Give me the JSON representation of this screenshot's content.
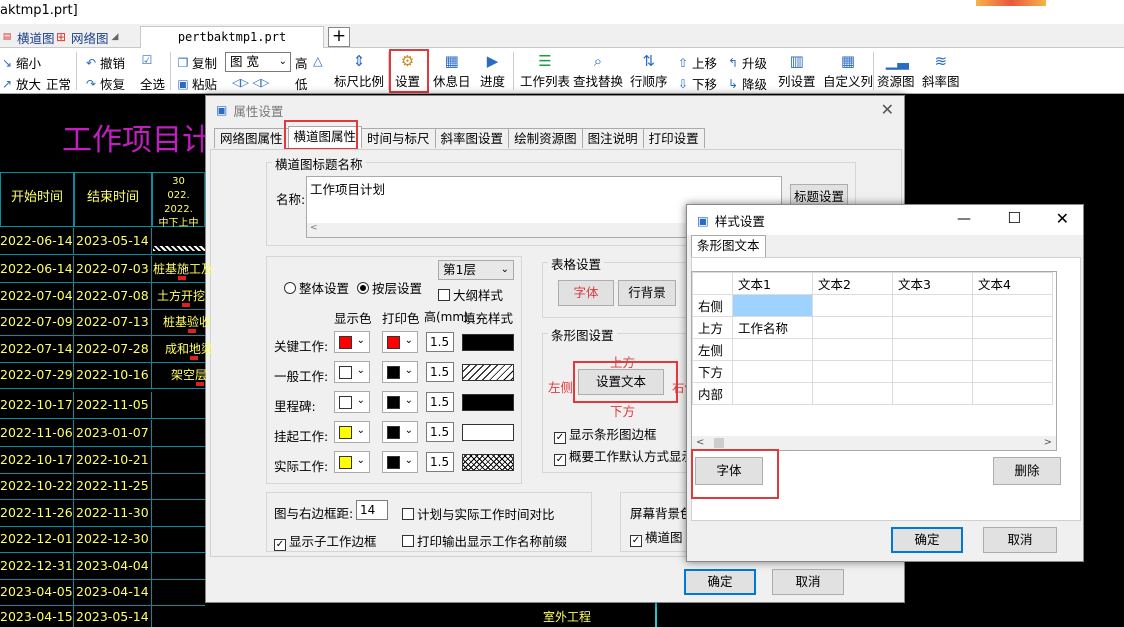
{
  "window": {
    "title_fragment": "aktmp1.prt]"
  },
  "tabbar": {
    "tabs": [
      {
        "label": "横道图",
        "icon": "gantt-icon"
      },
      {
        "label": "网络图",
        "icon": "network-icon"
      }
    ],
    "doc_tab": "pertbaktmp1.prt",
    "add_tab": "+"
  },
  "toolbar": {
    "zoom_out": "缩小",
    "zoom_in": "放大",
    "normal": "正常",
    "undo": "撤销",
    "redo": "恢复",
    "select_all": "全选",
    "copy": "复制",
    "paste": "粘贴",
    "view_select": "图 宽",
    "high": "高",
    "low": "低",
    "scale": "标尺比例",
    "settings": "设置",
    "holiday": "休息日",
    "progress": "进度",
    "work_list": "工作列表",
    "find_replace": "查找替换",
    "row_order": "行顺序",
    "move_up": "上移",
    "move_down": "下移",
    "upgrade": "升级",
    "downgrade": "降级",
    "col_settings": "列设置",
    "custom": "自定义列",
    "resource": "资源图",
    "slope": "斜率图"
  },
  "gantt": {
    "title": "工作项目计",
    "headers": {
      "start": "开始时间",
      "end": "结束时间",
      "scale_top": "30",
      "scale_mid": "022. 2022.",
      "scale_bot": "中下上中"
    },
    "rows": [
      {
        "start": "2022-06-14",
        "end": "2023-05-14",
        "task": ""
      },
      {
        "start": "2022-06-14",
        "end": "2022-07-03",
        "task": "桩基施工及"
      },
      {
        "start": "2022-07-04",
        "end": "2022-07-08",
        "task": "土方开挖"
      },
      {
        "start": "2022-07-09",
        "end": "2022-07-13",
        "task": "桩基验收"
      },
      {
        "start": "2022-07-14",
        "end": "2022-07-28",
        "task": "成和地梁"
      },
      {
        "start": "2022-07-29",
        "end": "2022-10-16",
        "task": "架空层"
      },
      {
        "start": "2022-10-17",
        "end": "2022-11-05",
        "task": ""
      },
      {
        "start": "2022-11-06",
        "end": "2023-01-07",
        "task": ""
      },
      {
        "start": "2022-10-17",
        "end": "2022-10-21",
        "task": ""
      },
      {
        "start": "2022-10-22",
        "end": "2022-11-25",
        "task": ""
      },
      {
        "start": "2022-11-26",
        "end": "2022-11-30",
        "task": ""
      },
      {
        "start": "2022-12-01",
        "end": "2022-12-30",
        "task": ""
      },
      {
        "start": "2022-12-31",
        "end": "2023-04-04",
        "task": ""
      },
      {
        "start": "2023-04-05",
        "end": "2023-04-14",
        "task": ""
      },
      {
        "start": "2023-04-15",
        "end": "2023-05-14",
        "task": "室外工程"
      }
    ]
  },
  "prop_dialog": {
    "title": "属性设置",
    "tabs": [
      "网络图属性",
      "横道图属性",
      "时间与标尺",
      "斜率图设置",
      "绘制资源图",
      "图注说明",
      "打印设置"
    ],
    "active_tab": "横道图属性",
    "title_group": "横道图标题名称",
    "name_label": "名称:",
    "name_value": "工作项目计划",
    "title_settings_btn": "标题设置",
    "radio_all": "整体设置",
    "radio_layer": "按层设置",
    "layer_select": "第1层",
    "outline_style": "大纲样式",
    "col_headers": {
      "display": "显示色",
      "print": "打印色",
      "height": "高(mm)",
      "fill": "填充样式"
    },
    "work_types": [
      {
        "label": "关键工作:",
        "display_color": "#ff0000",
        "print_color": "#ff0000",
        "height": "1.5",
        "fill": "solid"
      },
      {
        "label": "一般工作:",
        "display_color": "#ffffff",
        "print_color": "#000000",
        "height": "1.5",
        "fill": "hatch"
      },
      {
        "label": "里程碑:",
        "display_color": "#ffffff",
        "print_color": "#000000",
        "height": "1.5",
        "fill": "solid"
      },
      {
        "label": "挂起工作:",
        "display_color": "#ffff00",
        "print_color": "#000000",
        "height": "1.5",
        "fill": "empty"
      },
      {
        "label": "实际工作:",
        "display_color": "#ffff00",
        "print_color": "#000000",
        "height": "1.5",
        "fill": "cross"
      }
    ],
    "table_group": "表格设置",
    "font_btn": "字体",
    "row_bg_btn": "行背景",
    "bar_group": "条形图设置",
    "pos_top": "上方",
    "pos_left": "左侧",
    "pos_right": "右侧",
    "pos_bottom": "下方",
    "set_text_btn": "设置文本",
    "show_border": "显示条形图边框",
    "summary_default": "概要工作默认方式显示",
    "right_margin_label": "图与右边框距:",
    "right_margin_value": "14",
    "plan_vs_actual": "计划与实际工作时间对比",
    "show_sub_border": "显示子工作边框",
    "print_prefix": "打印输出显示工作名称前缀",
    "screen_bg": "屏幕背景色",
    "gantt_check": "横道图",
    "ok": "确定",
    "cancel": "取消"
  },
  "style_dialog": {
    "title": "样式设置",
    "tab": "条形图文本",
    "columns": [
      "文本1",
      "文本2",
      "文本3",
      "文本4"
    ],
    "rows": [
      {
        "label": "右侧",
        "cells": [
          "",
          "",
          "",
          ""
        ]
      },
      {
        "label": "上方",
        "cells": [
          "工作名称",
          "",
          "",
          ""
        ]
      },
      {
        "label": "左侧",
        "cells": [
          "",
          "",
          "",
          ""
        ]
      },
      {
        "label": "下方",
        "cells": [
          "",
          "",
          "",
          ""
        ]
      },
      {
        "label": "内部",
        "cells": [
          "",
          "",
          "",
          ""
        ]
      }
    ],
    "font_btn": "字体",
    "delete_btn": "删除",
    "ok": "确定",
    "cancel": "取消"
  }
}
